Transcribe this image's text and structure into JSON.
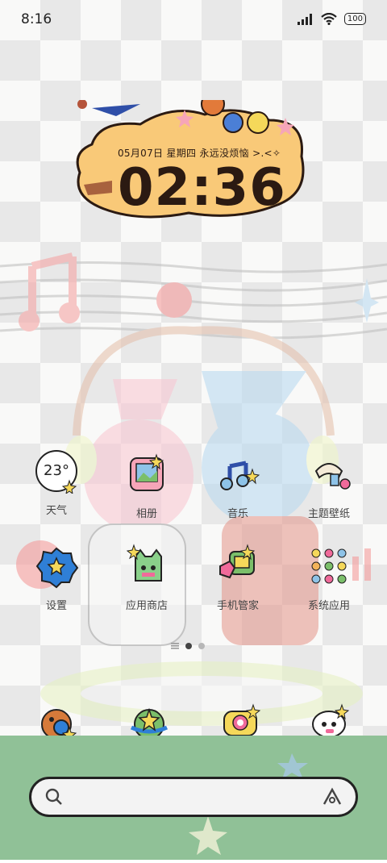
{
  "status_bar": {
    "time": "8:16",
    "battery": "100"
  },
  "clock_widget": {
    "date_line": "05月07日  星期四  永远没烦恼 >.<✧",
    "time": "02:36"
  },
  "weather": {
    "temperature": "23°"
  },
  "apps_row1": [
    {
      "label": "天气",
      "icon": "weather-icon"
    },
    {
      "label": "相册",
      "icon": "gallery-icon"
    },
    {
      "label": "音乐",
      "icon": "music-icon"
    },
    {
      "label": "主题壁纸",
      "icon": "themes-icon"
    }
  ],
  "apps_row2": [
    {
      "label": "设置",
      "icon": "settings-icon"
    },
    {
      "label": "应用商店",
      "icon": "app-store-icon"
    },
    {
      "label": "手机管家",
      "icon": "security-icon"
    },
    {
      "label": "系统应用",
      "icon": "system-apps-folder-icon"
    }
  ],
  "pages": {
    "count": 2,
    "current": 1
  },
  "dock": [
    {
      "icon": "phone-icon"
    },
    {
      "icon": "browser-icon"
    },
    {
      "icon": "messages-icon"
    },
    {
      "icon": "camera-icon"
    }
  ],
  "colors": {
    "dock_bg": "#90c197",
    "cloud": "#f9c978"
  }
}
